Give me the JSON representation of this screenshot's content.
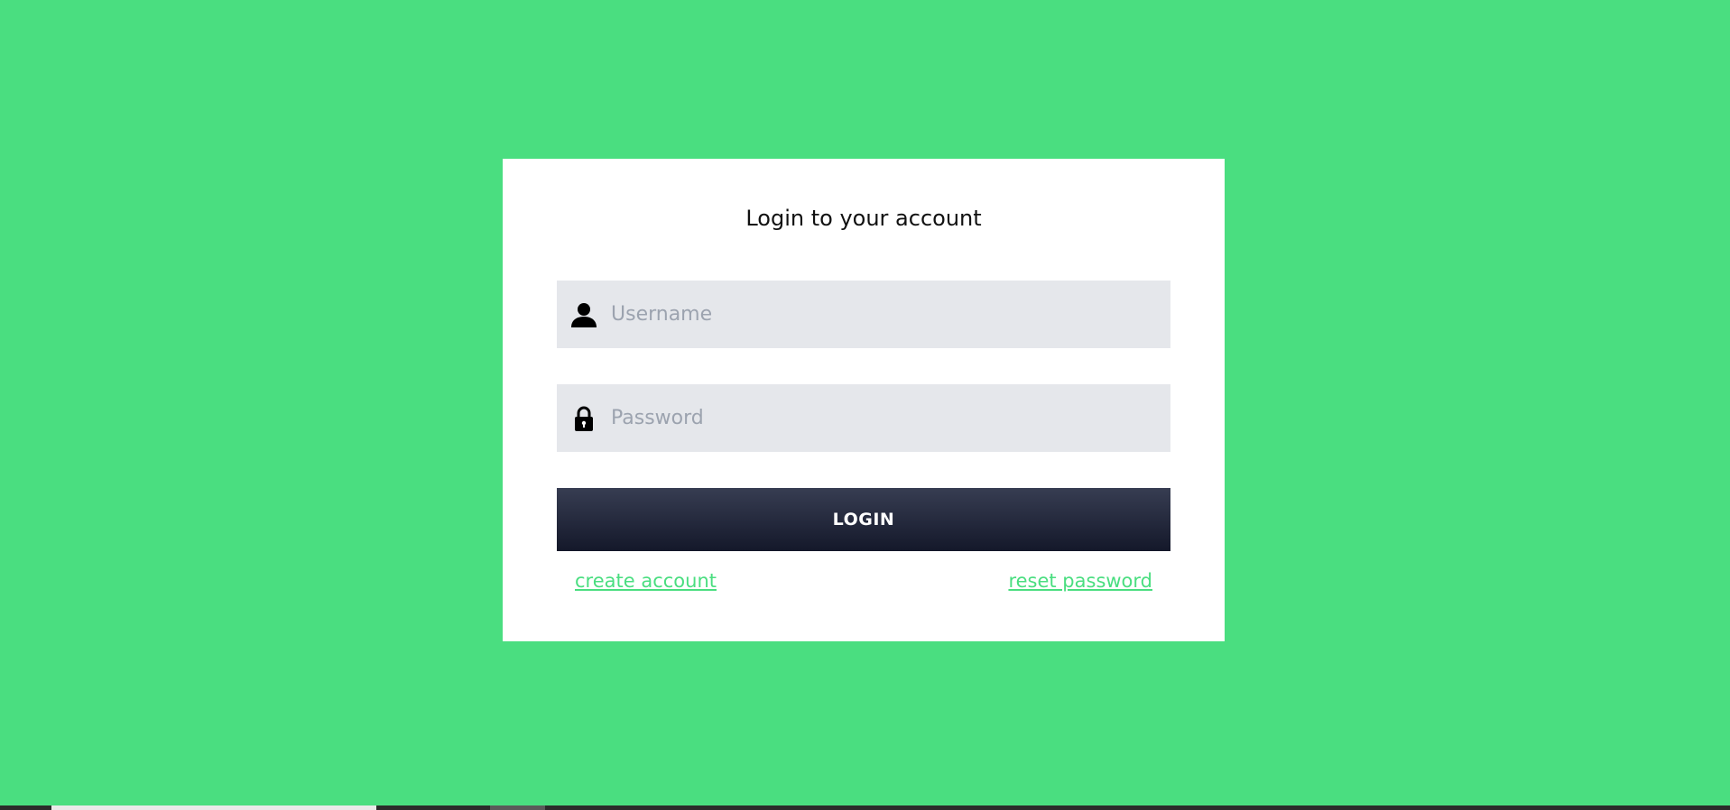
{
  "login": {
    "title": "Login to your account",
    "username_placeholder": "Username",
    "password_placeholder": "Password",
    "login_label": "LOGIN",
    "create_account_label": "create account",
    "reset_password_label": "reset password"
  },
  "icons": {
    "username": "user-icon",
    "password": "lock-icon"
  },
  "colors": {
    "background": "#4ade80",
    "card": "#ffffff",
    "input_bg": "#e5e7eb",
    "button_top": "#373d52",
    "button_bottom": "#14182a",
    "link": "#4ade80"
  }
}
